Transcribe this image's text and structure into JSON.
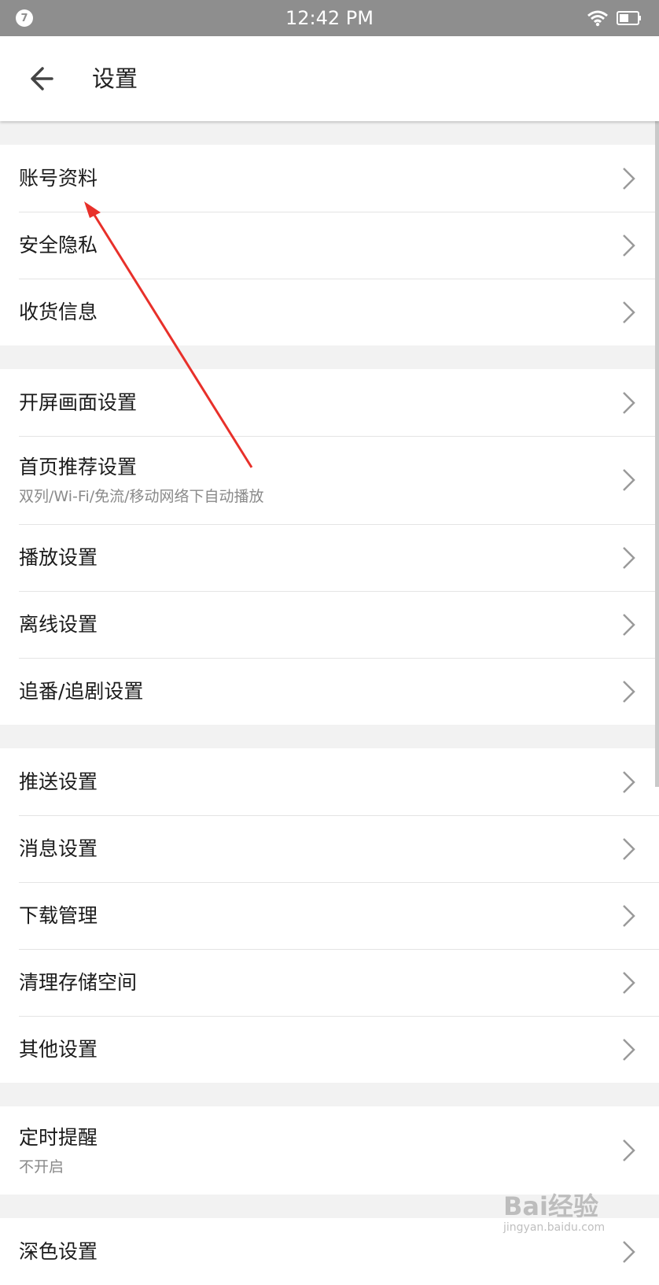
{
  "status_bar": {
    "badge": "7",
    "time": "12:42 PM",
    "icons": [
      "wifi-icon",
      "battery-icon"
    ]
  },
  "header": {
    "back_icon": "arrow-left-icon",
    "title": "设置"
  },
  "sections": [
    {
      "items": [
        {
          "label": "账号资料"
        },
        {
          "label": "安全隐私"
        },
        {
          "label": "收货信息"
        }
      ]
    },
    {
      "items": [
        {
          "label": "开屏画面设置"
        },
        {
          "label": "首页推荐设置",
          "sub": "双列/Wi-Fi/免流/移动网络下自动播放"
        },
        {
          "label": "播放设置"
        },
        {
          "label": "离线设置"
        },
        {
          "label": "追番/追剧设置"
        }
      ]
    },
    {
      "items": [
        {
          "label": "推送设置"
        },
        {
          "label": "消息设置"
        },
        {
          "label": "下载管理"
        },
        {
          "label": "清理存储空间"
        },
        {
          "label": "其他设置"
        }
      ]
    },
    {
      "items": [
        {
          "label": "定时提醒",
          "sub": "不开启"
        }
      ]
    },
    {
      "items": [
        {
          "label": "深色设置"
        }
      ]
    }
  ],
  "watermark": {
    "brand": "Bai经验",
    "url": "jingyan.baidu.com"
  },
  "colors": {
    "status_bar": "#8e8e8e",
    "background": "#f2f2f2",
    "annotation_arrow": "#e8302a"
  }
}
